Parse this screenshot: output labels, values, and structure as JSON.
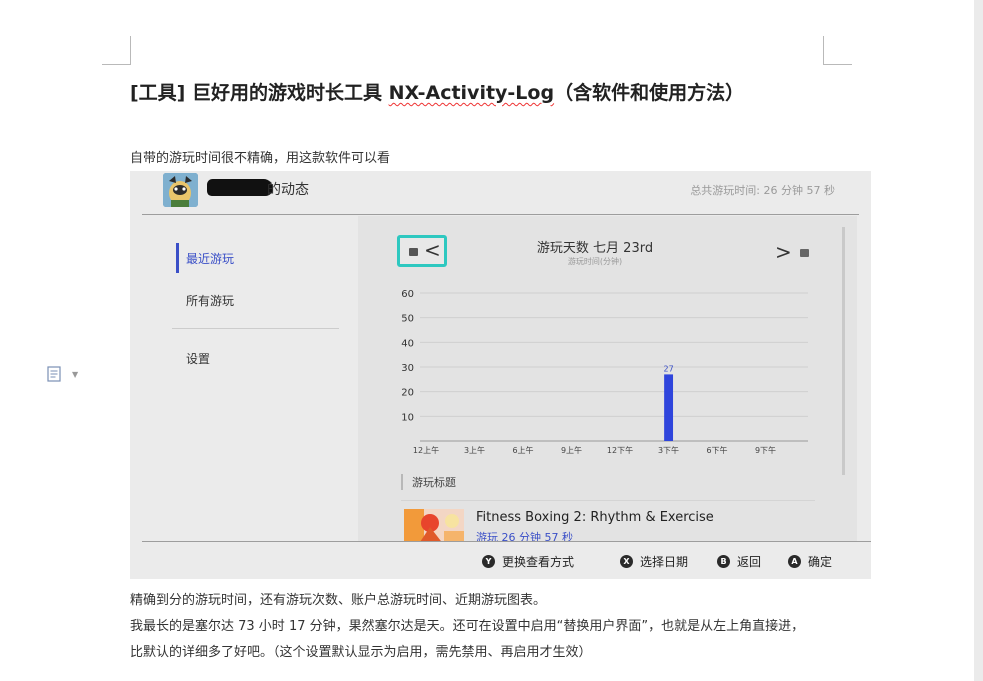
{
  "document": {
    "title_prefix": "[工具] 巨好用的游戏时长工具 ",
    "title_app": "NX-Activity-Log",
    "title_suffix": "（含软件和使用方法）",
    "intro": "自带的游玩时间很不精确，用这款软件可以看",
    "para_1": "精确到分的游玩时间，还有游玩次数、账户总游玩时间、近期游玩图表。",
    "para_2": "我最长的是塞尔达 73 小时 17 分钟，果然塞尔达是天。还可在设置中启用“替换用户界面”，也就是从左上角直接进，",
    "para_3": "比默认的详细多了好吧。（这个设置默认显示为启用，需先禁用、再启用才生效）"
  },
  "screenshot": {
    "header": {
      "name_suffix": "的动态",
      "total": "总共游玩时间: 26 分钟 57 秒"
    },
    "nav": {
      "recent": "最近游玩",
      "all": "所有游玩",
      "settings": "设置"
    },
    "chart_header": {
      "title": "游玩天数 七月 23rd",
      "subtitle": "游玩时间(分钟)"
    },
    "list_header": "游玩标题",
    "game": {
      "title": "Fitness Boxing 2: Rhythm & Exercise",
      "time": "游玩 26 分钟 57 秒"
    },
    "footer": [
      {
        "key": "Y",
        "label": "更换查看方式"
      },
      {
        "key": "X",
        "label": "选择日期"
      },
      {
        "key": "B",
        "label": "返回"
      },
      {
        "key": "A",
        "label": "确定"
      }
    ],
    "colors": {
      "accent": "#3a4fc7",
      "bar": "#2f45dc",
      "focus": "#2ec8c0"
    },
    "icons": {
      "prev": "chevron-left-icon",
      "next": "chevron-right-icon"
    }
  },
  "chart_data": {
    "type": "bar",
    "title": "游玩天数 七月 23rd",
    "ylabel": "游玩时间(分钟)",
    "ylim": [
      0,
      60
    ],
    "yticks": [
      10,
      20,
      30,
      40,
      50,
      60
    ],
    "tick_labels": [
      "12上午",
      "3上午",
      "6上午",
      "9上午",
      "12下午",
      "3下午",
      "6下午",
      "9下午"
    ],
    "hours": [
      0,
      24
    ],
    "bars": [
      {
        "hour": 15,
        "value": 27,
        "label": "27"
      }
    ]
  }
}
